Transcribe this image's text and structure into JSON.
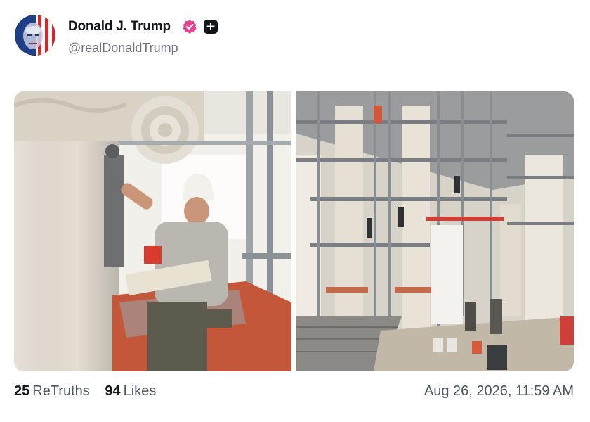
{
  "post": {
    "author": {
      "display_name": "Donald J. Trump",
      "handle": "@realDonaldTrump",
      "verified_badge": "verified-icon",
      "badge_color": "#e84393",
      "extra_badge": "plus-icon"
    },
    "media": [
      {
        "kind": "photo",
        "description_icon": "photo"
      },
      {
        "kind": "photo",
        "description_icon": "photo"
      }
    ],
    "stats": {
      "retruths_count": "25",
      "retruths_label": "ReTruths",
      "likes_count": "94",
      "likes_label": "Likes"
    },
    "timestamp": "Aug 26, 2026, 11:59 AM"
  }
}
